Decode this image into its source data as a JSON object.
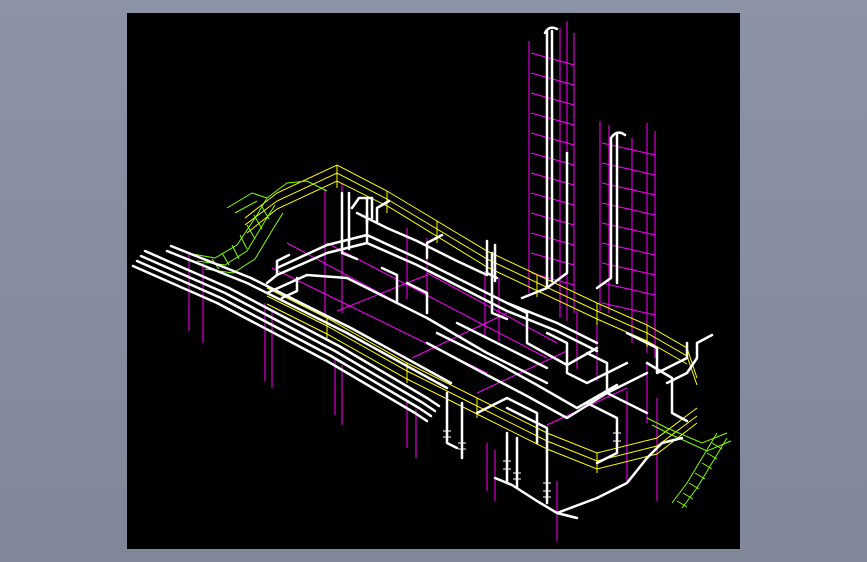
{
  "window": {
    "title": ""
  },
  "colors": {
    "background": "#7f8799",
    "viewport": "#000000",
    "pipe": "#ffffff",
    "railing": "#ffff00",
    "support": "#ff00ff",
    "stair": "#80ff00"
  },
  "drawing": {
    "view": "isometric-3d",
    "elements": [
      "pipe-rack",
      "process-piping",
      "handrail",
      "steel-column",
      "vertical-ladder",
      "access-stair"
    ]
  }
}
